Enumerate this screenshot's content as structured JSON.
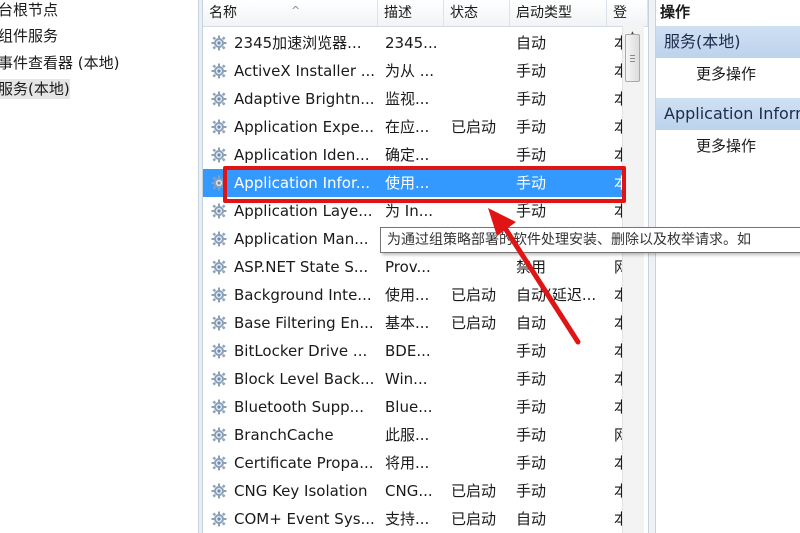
{
  "tree": {
    "items": [
      {
        "label": "台根节点",
        "selected": false
      },
      {
        "label": "组件服务",
        "selected": false
      },
      {
        "label": "事件查看器 (本地)",
        "selected": false
      },
      {
        "label": "服务(本地)",
        "selected": true
      }
    ]
  },
  "list": {
    "columns": {
      "name": "名称",
      "desc": "描述",
      "status": "状态",
      "startup": "启动类型",
      "logon": "登"
    },
    "rows": [
      {
        "name": "2345加速浏览器...",
        "desc": "2345...",
        "status": "",
        "startup": "自动",
        "logon": "本"
      },
      {
        "name": "ActiveX Installer ...",
        "desc": "为从 ...",
        "status": "",
        "startup": "手动",
        "logon": "本"
      },
      {
        "name": "Adaptive Brightn...",
        "desc": "监视...",
        "status": "",
        "startup": "手动",
        "logon": "本"
      },
      {
        "name": "Application Expe...",
        "desc": "在应...",
        "status": "已启动",
        "startup": "手动",
        "logon": "本"
      },
      {
        "name": "Application Iden...",
        "desc": "确定...",
        "status": "",
        "startup": "手动",
        "logon": "本"
      },
      {
        "name": "Application Infor...",
        "desc": "使用...",
        "status": "",
        "startup": "手动",
        "logon": "本"
      },
      {
        "name": "Application Laye...",
        "desc": "为 In...",
        "status": "",
        "startup": "手动",
        "logon": "本"
      },
      {
        "name": "Application Man...",
        "desc": "",
        "status": "",
        "startup": "",
        "logon": ""
      },
      {
        "name": "ASP.NET State S...",
        "desc": "Prov...",
        "status": "",
        "startup": "禁用",
        "logon": "网"
      },
      {
        "name": "Background Inte...",
        "desc": "使用...",
        "status": "已启动",
        "startup": "自动(延迟...",
        "logon": "本"
      },
      {
        "name": "Base Filtering En...",
        "desc": "基本...",
        "status": "已启动",
        "startup": "自动",
        "logon": "本"
      },
      {
        "name": "BitLocker Drive ...",
        "desc": "BDE...",
        "status": "",
        "startup": "手动",
        "logon": "本"
      },
      {
        "name": "Block Level Back...",
        "desc": "Win...",
        "status": "",
        "startup": "手动",
        "logon": "本"
      },
      {
        "name": "Bluetooth Supp...",
        "desc": "Blue...",
        "status": "",
        "startup": "手动",
        "logon": "本"
      },
      {
        "name": "BranchCache",
        "desc": "此服...",
        "status": "",
        "startup": "手动",
        "logon": "网"
      },
      {
        "name": "Certificate Propa...",
        "desc": "将用...",
        "status": "",
        "startup": "手动",
        "logon": "本"
      },
      {
        "name": "CNG Key Isolation",
        "desc": "CNG...",
        "status": "已启动",
        "startup": "手动",
        "logon": "本"
      },
      {
        "name": "COM+ Event Sys...",
        "desc": "支持...",
        "status": "已启动",
        "startup": "自动",
        "logon": "本"
      }
    ],
    "selected_index": 5
  },
  "tooltip": {
    "text": "为通过组策略部署的软件处理安装、删除以及枚举请求。如"
  },
  "actions": {
    "title": "操作",
    "sections": [
      {
        "label": "服务(本地)",
        "more": "更多操作"
      },
      {
        "label": "Application Information",
        "more": "更多操作"
      }
    ]
  },
  "icons": {
    "service": "gear-icon"
  },
  "colors": {
    "selection": "#3399ff",
    "highlight_box": "#e01414",
    "arrow": "#e01414",
    "section_bg": "#c6dbf1"
  }
}
